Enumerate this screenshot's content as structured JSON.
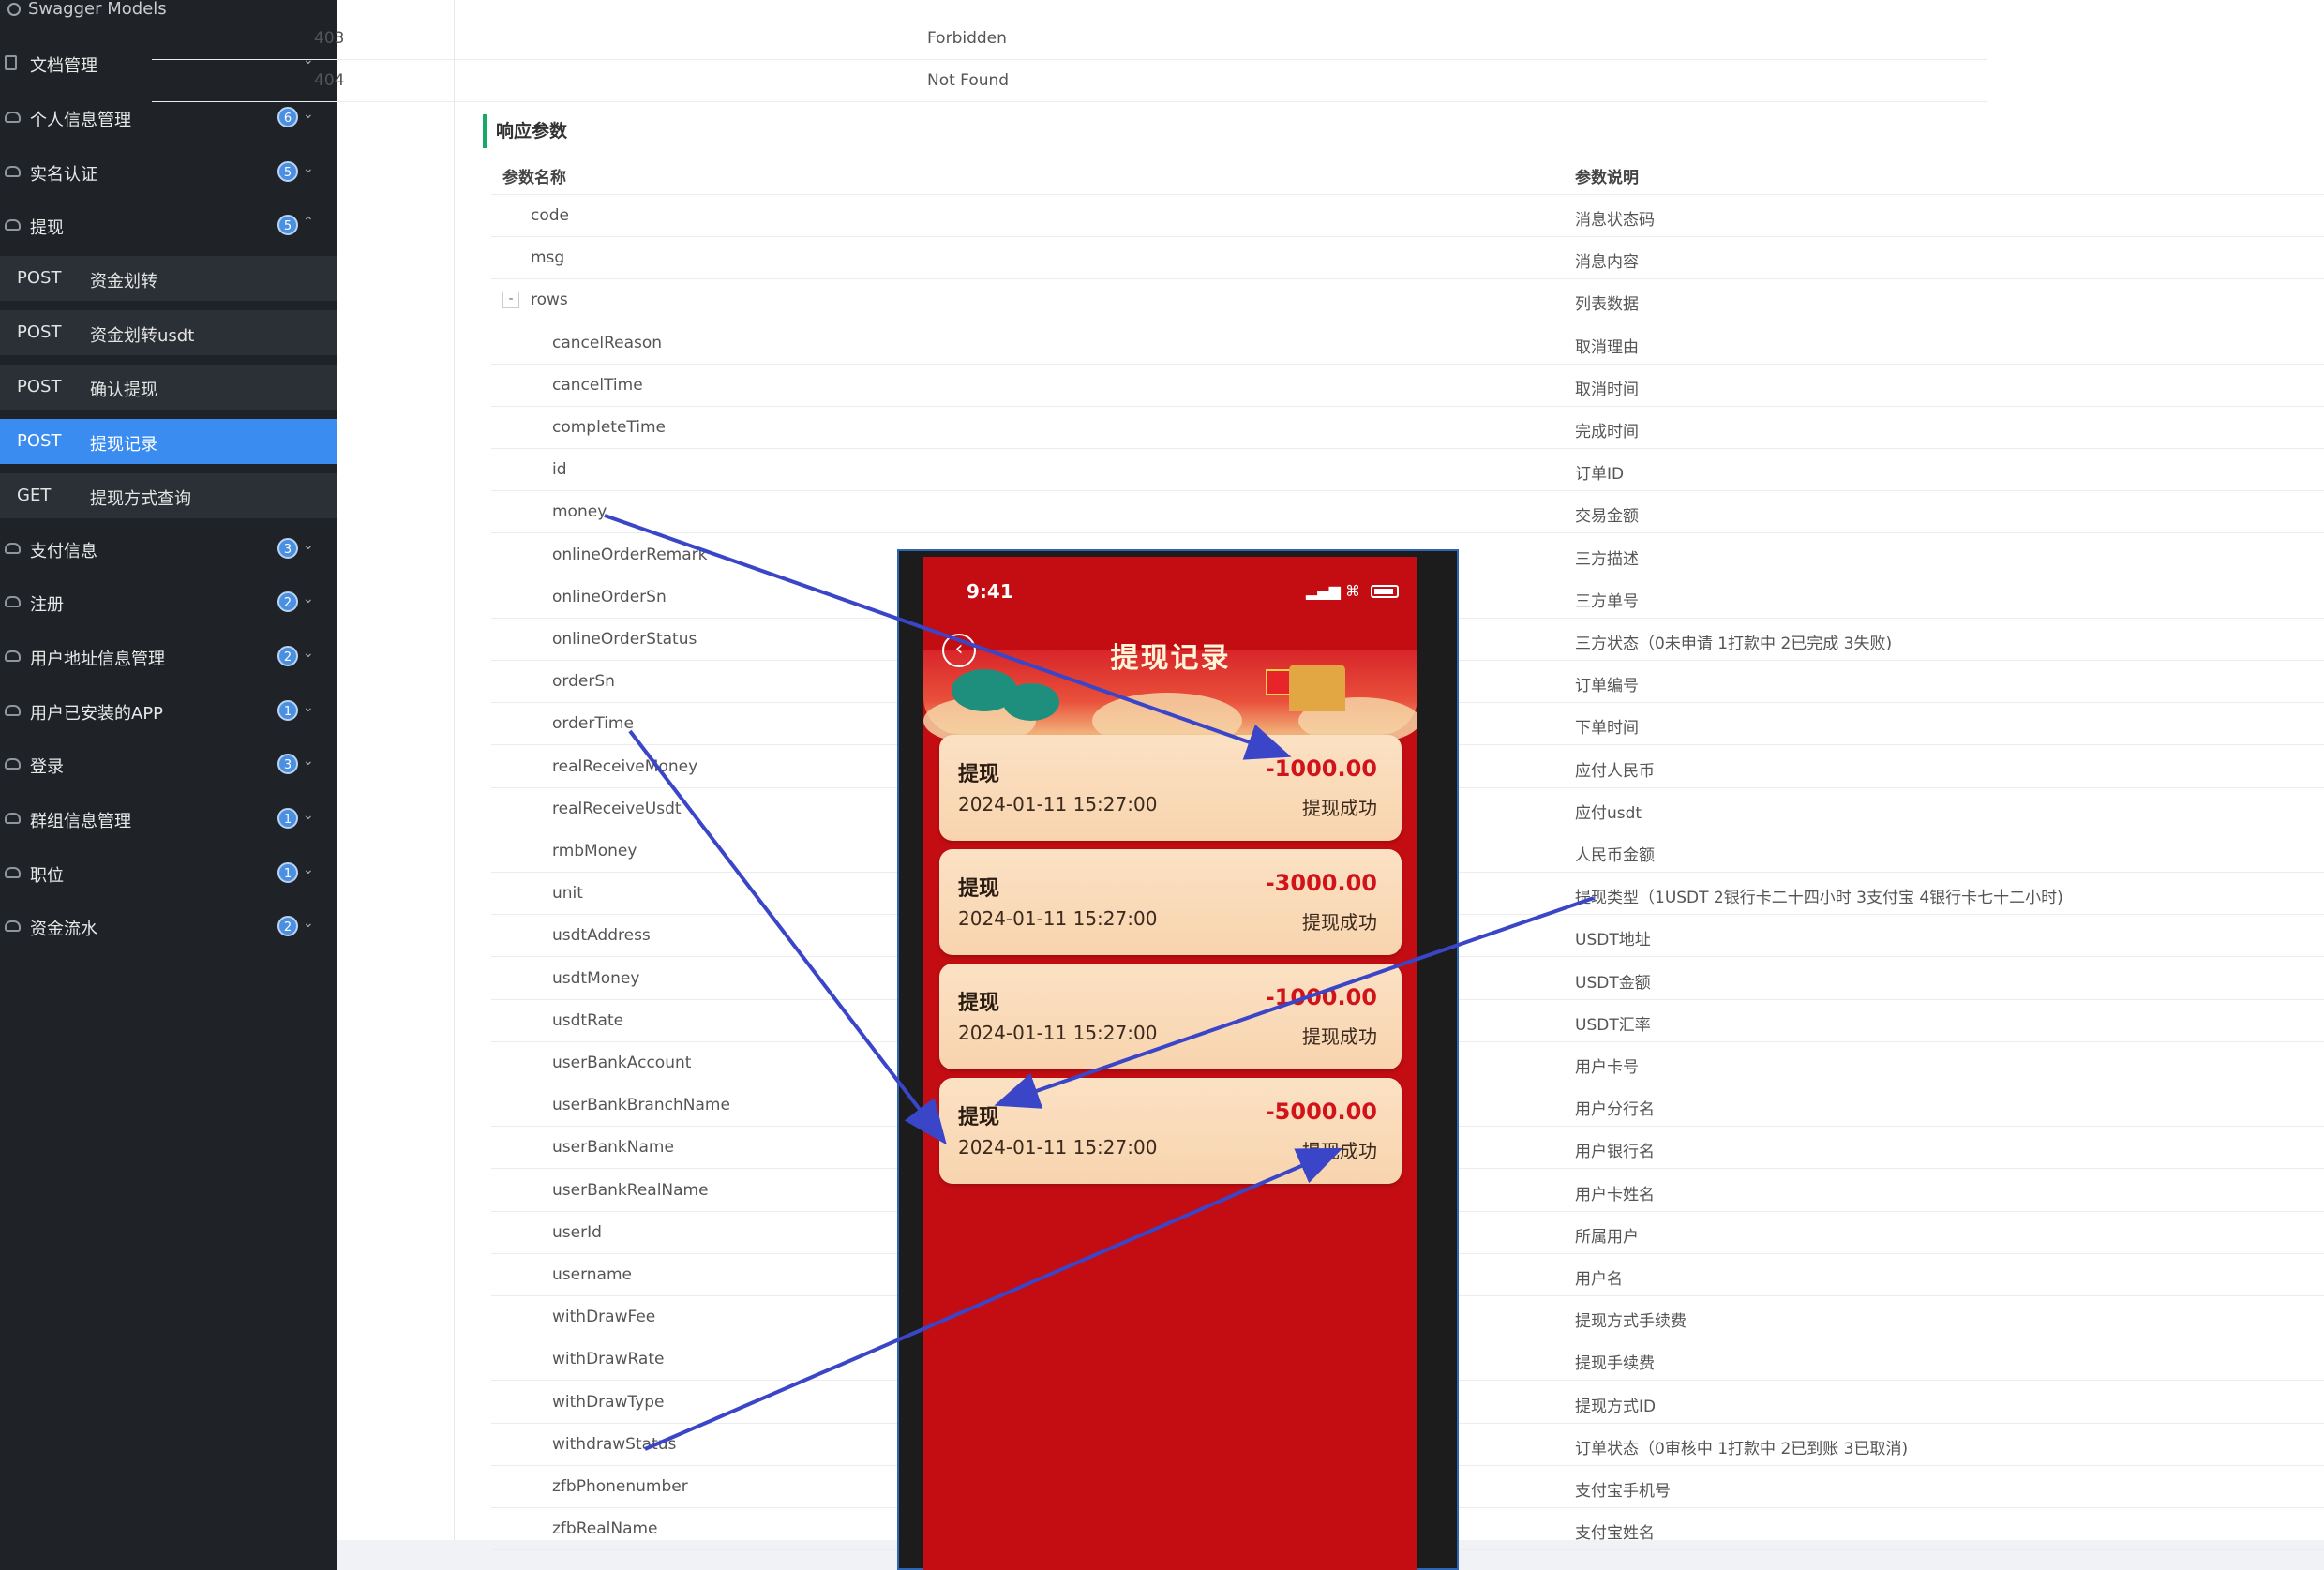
{
  "sidebar": {
    "top_label": "Swagger Models",
    "groups": [
      {
        "label": "文档管理",
        "badge": ""
      },
      {
        "label": "个人信息管理",
        "badge": "6"
      },
      {
        "label": "实名认证",
        "badge": "5"
      },
      {
        "label": "提现",
        "badge": "5"
      },
      {
        "label": "支付信息",
        "badge": "3"
      },
      {
        "label": "注册",
        "badge": "2"
      },
      {
        "label": "用户地址信息管理",
        "badge": "2"
      },
      {
        "label": "用户已安装的APP",
        "badge": "1"
      },
      {
        "label": "登录",
        "badge": "3"
      },
      {
        "label": "群组信息管理",
        "badge": "1"
      },
      {
        "label": "职位",
        "badge": "1"
      },
      {
        "label": "资金流水",
        "badge": "2"
      }
    ],
    "sub_items": [
      {
        "method": "POST",
        "name": "资金划转"
      },
      {
        "method": "POST",
        "name": "资金划转usdt"
      },
      {
        "method": "POST",
        "name": "确认提现"
      },
      {
        "method": "POST",
        "name": "提现记录"
      },
      {
        "method": "GET",
        "name": "提现方式查询"
      }
    ]
  },
  "status_rows": [
    {
      "code": "403",
      "desc": "Forbidden"
    },
    {
      "code": "404",
      "desc": "Not Found"
    }
  ],
  "response": {
    "section_title": "响应参数",
    "col_name": "参数名称",
    "col_desc": "参数说明",
    "params": [
      {
        "name": "code",
        "desc": "消息状态码"
      },
      {
        "name": "msg",
        "desc": "消息内容"
      },
      {
        "name": "rows",
        "desc": "列表数据"
      },
      {
        "name": "cancelReason",
        "desc": "取消理由"
      },
      {
        "name": "cancelTime",
        "desc": "取消时间"
      },
      {
        "name": "completeTime",
        "desc": "完成时间"
      },
      {
        "name": "id",
        "desc": "订单ID"
      },
      {
        "name": "money",
        "desc": "交易金额"
      },
      {
        "name": "onlineOrderRemark",
        "desc": "三方描述"
      },
      {
        "name": "onlineOrderSn",
        "desc": "三方单号"
      },
      {
        "name": "onlineOrderStatus",
        "desc": "三方状态（0未申请 1打款中 2已完成 3失败)"
      },
      {
        "name": "orderSn",
        "desc": "订单编号"
      },
      {
        "name": "orderTime",
        "desc": "下单时间"
      },
      {
        "name": "realReceiveMoney",
        "desc": "应付人民币"
      },
      {
        "name": "realReceiveUsdt",
        "desc": "应付usdt"
      },
      {
        "name": "rmbMoney",
        "desc": "人民币金额"
      },
      {
        "name": "unit",
        "desc": "提现类型（1USDT 2银行卡二十四小时 3支付宝 4银行卡七十二小时)"
      },
      {
        "name": "usdtAddress",
        "desc": "USDT地址"
      },
      {
        "name": "usdtMoney",
        "desc": "USDT金额"
      },
      {
        "name": "usdtRate",
        "desc": "USDT汇率"
      },
      {
        "name": "userBankAccount",
        "desc": "用户卡号"
      },
      {
        "name": "userBankBranchName",
        "desc": "用户分行名"
      },
      {
        "name": "userBankName",
        "desc": "用户银行名"
      },
      {
        "name": "userBankRealName",
        "desc": "用户卡姓名"
      },
      {
        "name": "userId",
        "desc": "所属用户"
      },
      {
        "name": "username",
        "desc": "用户名"
      },
      {
        "name": "withDrawFee",
        "desc": "提现方式手续费"
      },
      {
        "name": "withDrawRate",
        "desc": "提现手续费"
      },
      {
        "name": "withDrawType",
        "desc": "提现方式ID"
      },
      {
        "name": "withdrawStatus",
        "desc": "订单状态（0审核中 1打款中 2已到账 3已取消)"
      },
      {
        "name": "zfbPhonenumber",
        "desc": "支付宝手机号"
      },
      {
        "name": "zfbRealName",
        "desc": "支付宝姓名"
      }
    ]
  },
  "phone": {
    "time": "9:41",
    "title": "提现记录",
    "cards": [
      {
        "title": "提现",
        "date": "2024-01-11 15:27:00",
        "amount": "-1000.00",
        "status": "提现成功"
      },
      {
        "title": "提现",
        "date": "2024-01-11 15:27:00",
        "amount": "-3000.00",
        "status": "提现成功"
      },
      {
        "title": "提现",
        "date": "2024-01-11 15:27:00",
        "amount": "-1000.00",
        "status": "提现成功"
      },
      {
        "title": "提现",
        "date": "2024-01-11 15:27:00",
        "amount": "-5000.00",
        "status": "提现成功"
      }
    ]
  },
  "colors": {
    "sidebar_bg": "#1f2327",
    "active_item": "#3b8cf0",
    "section_accent": "#1aa867",
    "phone_red": "#c30d12",
    "arrow": "#3a45c8"
  }
}
